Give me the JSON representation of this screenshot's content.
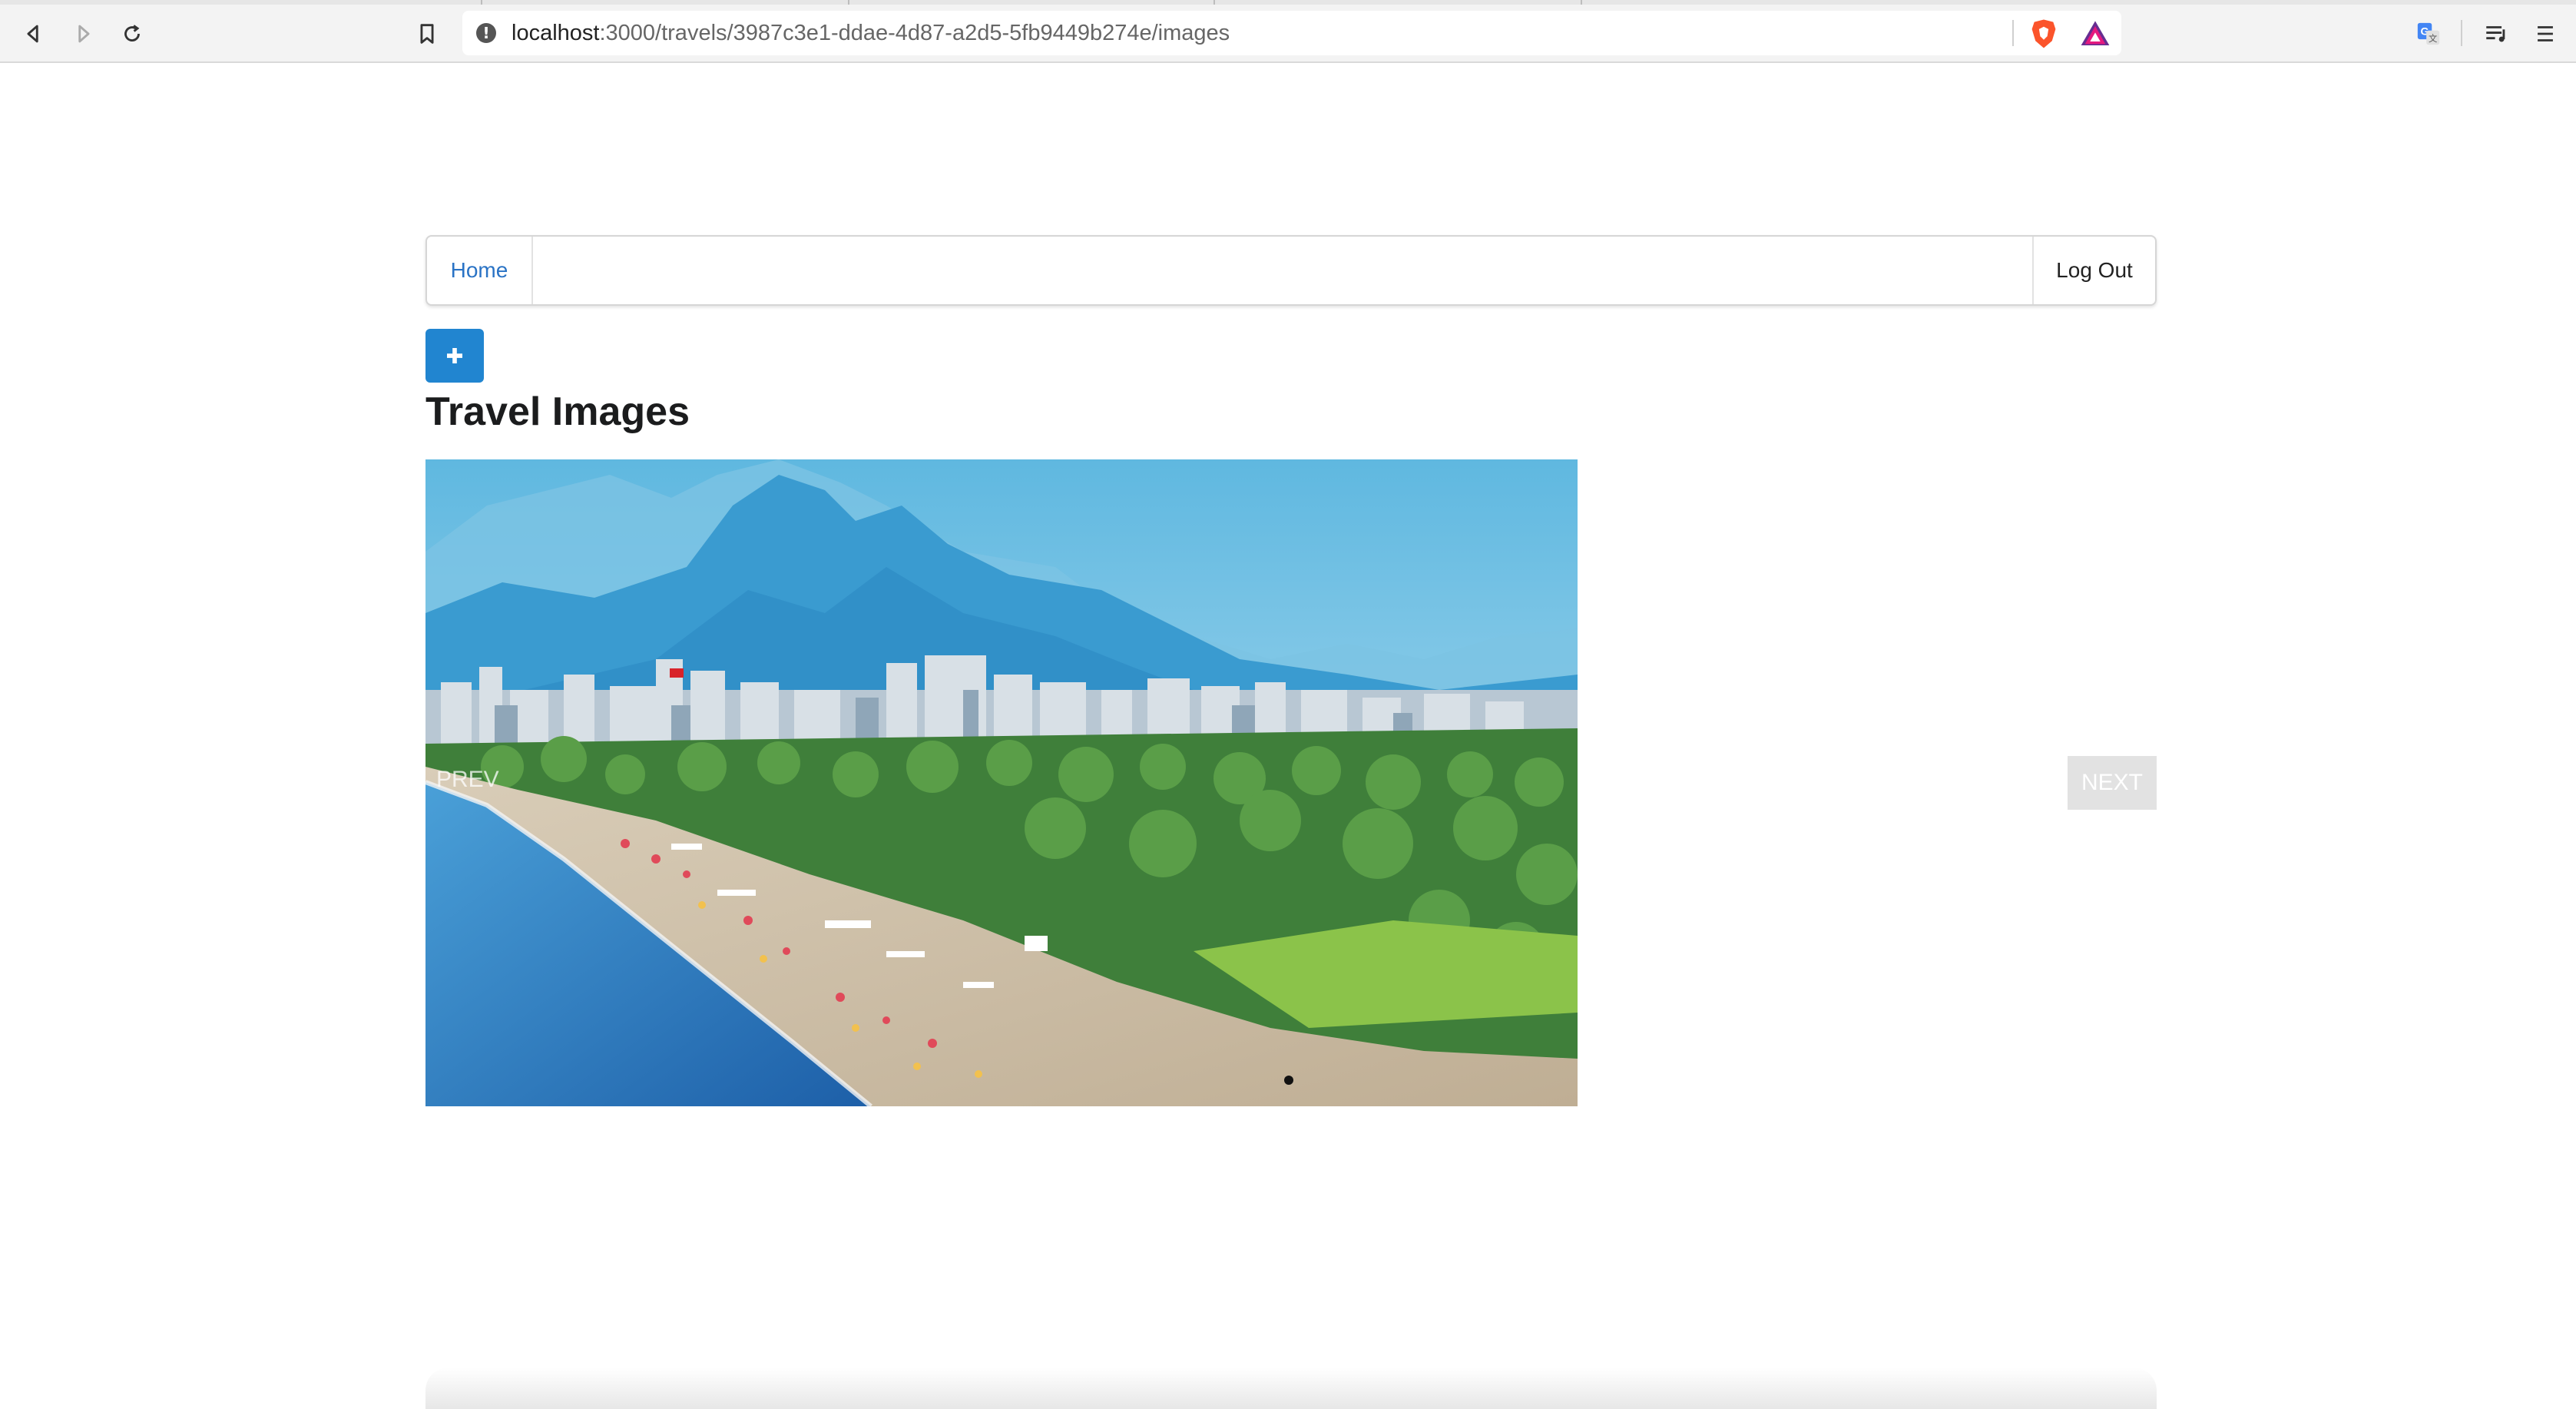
{
  "browser": {
    "url_host": "localhost",
    "url_path": ":3000/travels/3987c3e1-ddae-4d87-a2d5-5fb9449b274e/images",
    "icons": [
      "back-icon",
      "forward-icon",
      "reload-icon",
      "bookmark-icon",
      "site-info-icon",
      "brave-shields-icon",
      "brave-rewards-icon",
      "translate-icon",
      "playlist-icon",
      "menu-icon"
    ]
  },
  "navbar": {
    "home_label": "Home",
    "logout_label": "Log Out"
  },
  "add_button": {
    "icon": "plus-icon",
    "color": "#2185d0"
  },
  "page": {
    "title": "Travel Images"
  },
  "carousel": {
    "prev_label": "PREV",
    "next_label": "NEXT",
    "slide_count": 1,
    "active_slide": 1
  },
  "colors": {
    "link": "#2a73c5",
    "primary": "#2185d0"
  }
}
